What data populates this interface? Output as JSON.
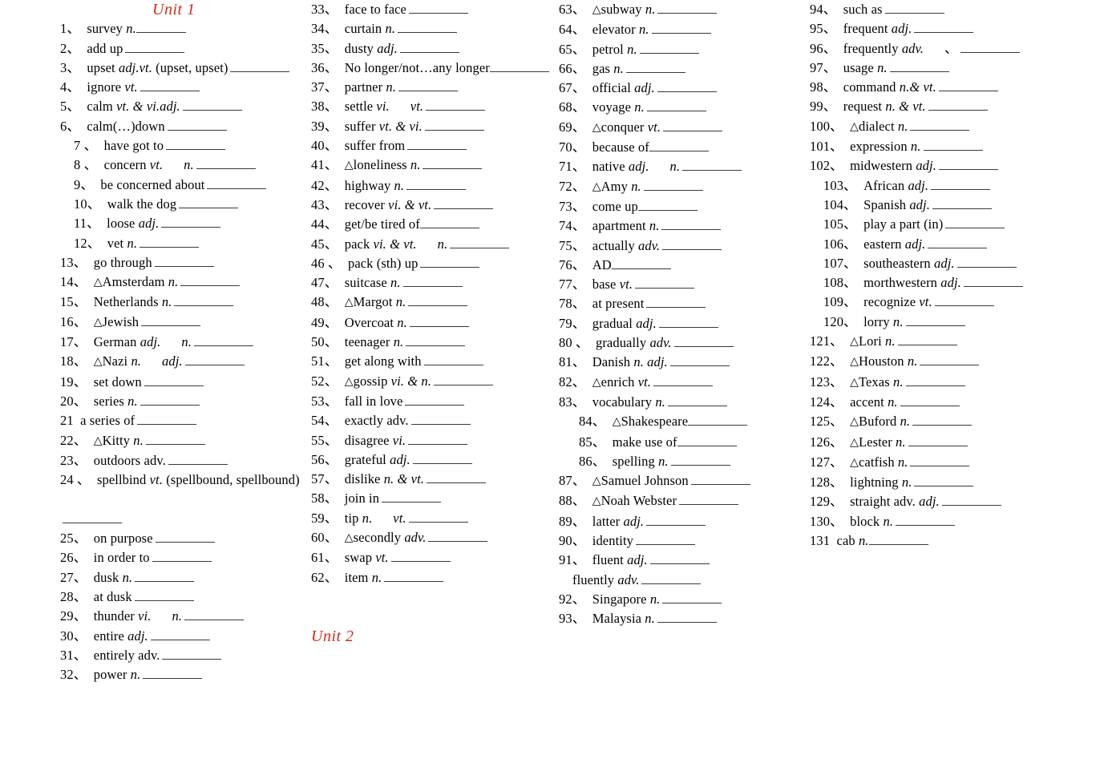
{
  "document": {
    "title": "Unit 1 & Unit 2 Vocabulary Worksheet",
    "accent_color": "#d42b1e",
    "text_color": "#000000",
    "background_color": "#ffffff",
    "rule_color": "#3a3a3a"
  },
  "headings": {
    "unit_1": "Unit 1",
    "unit_2": "Unit 2"
  },
  "columns": [
    {
      "id": "col-1",
      "heading": "Unit 1",
      "entries": [
        {
          "num": "1、",
          "word": "survey",
          "pos": "n.",
          "blank": "sm",
          "indent": 0,
          "space_before_blank": false
        },
        {
          "num": "2、",
          "word": "add up",
          "pos": "",
          "blank": "md",
          "indent": 0
        },
        {
          "num": "3、",
          "word": "upset",
          "pos": "adj.vt.",
          "tail": "(upset, upset)",
          "blank": "md",
          "indent": 0
        },
        {
          "num": "4、",
          "word": "ignore",
          "pos": "vt.",
          "blank": "md",
          "indent": 0
        },
        {
          "num": "5、",
          "word": "calm",
          "pos": "vt. & vi.adj.",
          "blank": "md",
          "indent": 0
        },
        {
          "num": "6、",
          "word": "calm(…)down",
          "pos": "",
          "blank": "md",
          "indent": 0
        },
        {
          "num": "7 、",
          "word": "have got to",
          "pos": "",
          "blank": "md",
          "indent": 1
        },
        {
          "num": "8 、",
          "word": "concern",
          "pos": "vt.",
          "pos2": "n.",
          "blank": "md",
          "indent": 1
        },
        {
          "num": "9、",
          "word": "be concerned about",
          "pos": "",
          "blank": "md",
          "indent": 1
        },
        {
          "num": "10、",
          "word": "walk the dog",
          "pos": "",
          "blank": "md",
          "indent": 1
        },
        {
          "num": "11、",
          "word": "loose",
          "pos": "adj.",
          "blank": "md",
          "indent": 1
        },
        {
          "num": "12、",
          "word": "vet",
          "pos": "n.",
          "blank": "md",
          "indent": 1
        },
        {
          "num": "13、",
          "word": "go through",
          "pos": "",
          "blank": "md",
          "indent": 0
        },
        {
          "num": "14、",
          "word": "Amsterdam",
          "pos": "n.",
          "triangle": true,
          "blank": "md",
          "indent": 0
        },
        {
          "num": "15、",
          "word": "Netherlands",
          "pos": "n.",
          "blank": "md",
          "indent": 0
        },
        {
          "num": "16、",
          "word": "Jewish",
          "pos": "",
          "triangle": true,
          "blank": "md",
          "indent": 0
        },
        {
          "num": "17、",
          "word": "German",
          "pos": "adj.",
          "pos2": "n.",
          "blank": "md",
          "indent": 0
        },
        {
          "num": "18、",
          "word": "Nazi",
          "pos": "n.",
          "pos2": "adj.",
          "triangle": true,
          "blank": "md",
          "indent": 0
        },
        {
          "num": "19、",
          "word": "set down",
          "pos": "",
          "blank": "md",
          "indent": 0
        },
        {
          "num": "20、",
          "word": "series",
          "pos": "n.",
          "blank": "md",
          "indent": 0
        },
        {
          "num": "21",
          "word": "a series of",
          "pos": "",
          "blank": "md",
          "indent": 0
        },
        {
          "num": "22、",
          "word": "Kitty",
          "pos": "n.",
          "triangle": true,
          "blank": "md",
          "indent": 0
        },
        {
          "num": "23、",
          "word": "outdoors adv.",
          "pos": "",
          "blank": "md",
          "indent": 0
        },
        {
          "num": "24 、",
          "word": "spellbind",
          "pos": "vt.",
          "tail": "(spellbound,  spellbound)",
          "blank": "md",
          "indent": 0,
          "wraps": true
        },
        {
          "num": "25、",
          "word": "on purpose",
          "pos": "",
          "blank": "md",
          "indent": 0
        },
        {
          "num": "26、",
          "word": "in order to",
          "pos": "",
          "blank": "md",
          "indent": 0
        },
        {
          "num": "27、",
          "word": "dusk",
          "pos": "n.",
          "blank": "md",
          "indent": 0
        },
        {
          "num": "28、",
          "word": "at dusk",
          "pos": "",
          "blank": "md",
          "indent": 0
        },
        {
          "num": "29、",
          "word": "thunder",
          "pos": "vi.",
          "pos2": "n.",
          "blank": "md",
          "indent": 0
        },
        {
          "num": "30、",
          "word": "entire",
          "pos": "adj.",
          "blank": "md",
          "indent": 0
        },
        {
          "num": "31、",
          "word": "entirely adv.",
          "pos": "",
          "blank": "md",
          "indent": 0
        },
        {
          "num": "32、",
          "word": "power",
          "pos": "n.",
          "blank": "md",
          "indent": 0
        }
      ]
    },
    {
      "id": "col-2",
      "heading": "Unit 2",
      "entries": [
        {
          "num": "33、",
          "word": "face to face",
          "pos": "",
          "blank": "md",
          "indent": 0
        },
        {
          "num": "34、",
          "word": "curtain",
          "pos": "n.",
          "blank": "md",
          "indent": 0
        },
        {
          "num": "35、",
          "word": "dusty",
          "pos": "adj.",
          "blank": "md",
          "indent": 0
        },
        {
          "num": "36、",
          "word": "No longer/not…any longer",
          "pos": "",
          "blank": "md",
          "indent": 0,
          "space_before_blank": false
        },
        {
          "num": "37、",
          "word": "partner",
          "pos": "n.",
          "blank": "md",
          "indent": 0
        },
        {
          "num": "38、",
          "word": "settle",
          "pos": "vi.",
          "pos2": "vt.",
          "blank": "md",
          "indent": 0
        },
        {
          "num": "39、",
          "word": "suffer",
          "pos": "vt. & vi.",
          "blank": "md",
          "indent": 0
        },
        {
          "num": "40、",
          "word": "suffer from",
          "pos": "",
          "blank": "md",
          "indent": 0
        },
        {
          "num": "41、",
          "word": "loneliness",
          "pos": "n.",
          "triangle": true,
          "blank": "md",
          "indent": 0
        },
        {
          "num": "42、",
          "word": "highway",
          "pos": "n.",
          "blank": "md",
          "indent": 0
        },
        {
          "num": "43、",
          "word": "recover",
          "pos": "vi. & vt.",
          "blank": "md",
          "indent": 0
        },
        {
          "num": "44、",
          "word": "get/be tired of",
          "pos": "",
          "blank": "md",
          "indent": 0,
          "space_before_blank": false
        },
        {
          "num": "45、",
          "word": "pack",
          "pos": "vi. & vt.",
          "pos2": "n.",
          "blank": "md",
          "indent": 0
        },
        {
          "num": "46 、",
          "word": "pack (sth) up",
          "pos": "",
          "blank": "md",
          "indent": 0
        },
        {
          "num": "47、",
          "word": "suitcase",
          "pos": "n.",
          "blank": "md",
          "indent": 0
        },
        {
          "num": "48、",
          "word": "Margot",
          "pos": "n.",
          "triangle": true,
          "blank": "md",
          "indent": 0
        },
        {
          "num": "49、",
          "word": "Overcoat",
          "pos": "n.",
          "blank": "md",
          "indent": 0
        },
        {
          "num": "50、",
          "word": "teenager",
          "pos": "n.",
          "blank": "md",
          "indent": 0
        },
        {
          "num": "51、",
          "word": "get along with",
          "pos": "",
          "blank": "md",
          "indent": 0
        },
        {
          "num": "52、",
          "word": "gossip",
          "pos": "vi. & n.",
          "triangle": true,
          "blank": "md",
          "indent": 0
        },
        {
          "num": "53、",
          "word": "fall in love",
          "pos": "",
          "blank": "md",
          "indent": 0
        },
        {
          "num": "54、",
          "word": "exactly adv.",
          "pos": "",
          "blank": "md",
          "indent": 0
        },
        {
          "num": "55、",
          "word": "disagree",
          "pos": "vi.",
          "blank": "md",
          "indent": 0
        },
        {
          "num": "56、",
          "word": "grateful",
          "pos": "adj.",
          "blank": "md",
          "indent": 0
        },
        {
          "num": "57、",
          "word": "dislike",
          "pos": "n. & vt.",
          "blank": "md",
          "indent": 0
        },
        {
          "num": "58、",
          "word": "join in",
          "pos": "",
          "blank": "md",
          "indent": 0
        },
        {
          "num": "59、",
          "word": "tip",
          "pos": "n.",
          "pos2": "vt.",
          "blank": "md",
          "indent": 0
        },
        {
          "num": "60、",
          "word": "secondly",
          "pos": "adv.",
          "triangle": true,
          "blank": "md",
          "indent": 0
        },
        {
          "num": "61、",
          "word": "swap",
          "pos": "vt.",
          "blank": "md",
          "indent": 0
        },
        {
          "num": "62、",
          "word": "item",
          "pos": "n.",
          "blank": "md",
          "indent": 0
        }
      ]
    },
    {
      "id": "col-3",
      "heading": "",
      "entries": [
        {
          "num": "63、",
          "word": "subway",
          "pos": "n.",
          "triangle": true,
          "blank": "md",
          "indent": 0
        },
        {
          "num": "64、",
          "word": "elevator",
          "pos": "n.",
          "blank": "md",
          "indent": 0
        },
        {
          "num": "65、",
          "word": "petrol",
          "pos": "n.",
          "blank": "md",
          "indent": 0
        },
        {
          "num": "66、",
          "word": "gas",
          "pos": "n.",
          "blank": "md",
          "indent": 0
        },
        {
          "num": "67、",
          "word": "official",
          "pos": "adj.",
          "blank": "md",
          "indent": 0
        },
        {
          "num": "68、",
          "word": "voyage",
          "pos": "n.",
          "blank": "md",
          "indent": 0
        },
        {
          "num": "69、",
          "word": "conquer",
          "pos": "vt.",
          "triangle": true,
          "blank": "md",
          "indent": 0
        },
        {
          "num": "70、",
          "word": "because of",
          "pos": "",
          "blank": "md",
          "indent": 0,
          "space_before_blank": false
        },
        {
          "num": "71、",
          "word": "native",
          "pos": "adj.",
          "pos2": "n.",
          "blank": "md",
          "indent": 0
        },
        {
          "num": "72、",
          "word": "Amy",
          "pos": "n.",
          "triangle": true,
          "blank": "md",
          "indent": 0
        },
        {
          "num": "73、",
          "word": "come up",
          "pos": "",
          "blank": "md",
          "indent": 0,
          "space_before_blank": false
        },
        {
          "num": "74、",
          "word": "apartment",
          "pos": "n.",
          "blank": "md",
          "indent": 0
        },
        {
          "num": "75、",
          "word": "actually",
          "pos": "adv.",
          "blank": "md",
          "indent": 0
        },
        {
          "num": "76、",
          "word": "AD",
          "pos": "",
          "blank": "md",
          "indent": 0,
          "space_before_blank": false
        },
        {
          "num": "77、",
          "word": "base",
          "pos": "vt.",
          "blank": "md",
          "indent": 0
        },
        {
          "num": "78、",
          "word": "at present",
          "pos": "",
          "blank": "md",
          "indent": 0
        },
        {
          "num": "79、",
          "word": "gradual",
          "pos": "adj.",
          "blank": "md",
          "indent": 0
        },
        {
          "num": "80 、",
          "word": "gradually",
          "pos": "adv.",
          "blank": "md",
          "indent": 0
        },
        {
          "num": "81、",
          "word": "Danish",
          "pos": "n. adj.",
          "blank": "md",
          "indent": 0
        },
        {
          "num": "82、",
          "word": "enrich",
          "pos": "vt.",
          "triangle": true,
          "blank": "md",
          "indent": 0
        },
        {
          "num": "83、",
          "word": "vocabulary",
          "pos": "n.",
          "blank": "md",
          "indent": 0
        },
        {
          "num": "84、",
          "word": "Shakespeare",
          "pos": "",
          "triangle": true,
          "blank": "md",
          "indent": 2,
          "space_before_blank": false
        },
        {
          "num": "85、",
          "word": "make use of",
          "pos": "",
          "blank": "md",
          "indent": 2,
          "space_before_blank": false
        },
        {
          "num": "86、",
          "word": "spelling",
          "pos": "n.",
          "blank": "md",
          "indent": 2
        },
        {
          "num": "87、",
          "word": "Samuel Johnson",
          "pos": "",
          "triangle": true,
          "blank": "md",
          "indent": 0
        },
        {
          "num": "88、",
          "word": "Noah Webster",
          "pos": "",
          "triangle": true,
          "blank": "md",
          "indent": 0
        },
        {
          "num": "89、",
          "word": "latter",
          "pos": "adj.",
          "blank": "md",
          "indent": 0
        },
        {
          "num": "90、",
          "word": "identity",
          "pos": "",
          "blank": "md",
          "indent": 0
        },
        {
          "num": "91、",
          "word": "fluent",
          "pos": "adj.",
          "blank": "md",
          "indent": 0
        },
        {
          "num": "",
          "word": "fluently",
          "pos": "adv.",
          "blank": "md",
          "indent": 1
        },
        {
          "num": "92、",
          "word": "Singapore",
          "pos": "n.",
          "blank": "md",
          "indent": 0
        },
        {
          "num": "93、",
          "word": "Malaysia",
          "pos": "n.",
          "blank": "md",
          "indent": 0
        }
      ]
    },
    {
      "id": "col-4",
      "heading": "",
      "entries": [
        {
          "num": "94、",
          "word": "such as",
          "pos": "",
          "blank": "md",
          "indent": 0
        },
        {
          "num": "95、",
          "word": "frequent",
          "pos": "adj.",
          "blank": "md",
          "indent": 0
        },
        {
          "num": "96、",
          "word": "frequently",
          "pos": "adv.",
          "pos2": "、",
          "blank": "md",
          "indent": 0
        },
        {
          "num": "97、",
          "word": "usage",
          "pos": "n.",
          "blank": "md",
          "indent": 0
        },
        {
          "num": "98、",
          "word": "command",
          "pos": "n.& vt.",
          "blank": "md",
          "indent": 0
        },
        {
          "num": "99、",
          "word": "request",
          "pos": "n. & vt.",
          "blank": "md",
          "indent": 0
        },
        {
          "num": "100、",
          "word": "dialect",
          "pos": "n.",
          "triangle": true,
          "blank": "md",
          "indent": 0
        },
        {
          "num": "101、",
          "word": "expression",
          "pos": "n.",
          "blank": "md",
          "indent": 0
        },
        {
          "num": "102、",
          "word": "midwestern",
          "pos": "adj.",
          "blank": "md",
          "indent": 0
        },
        {
          "num": "103、",
          "word": "African",
          "pos": "adj.",
          "blank": "md",
          "indent": 1
        },
        {
          "num": "104、",
          "word": "Spanish",
          "pos": "adj.",
          "blank": "md",
          "indent": 1
        },
        {
          "num": "105、",
          "word": "play a part (in)",
          "pos": "",
          "blank": "md",
          "indent": 1
        },
        {
          "num": "106、",
          "word": "eastern",
          "pos": "adj.",
          "blank": "md",
          "indent": 1
        },
        {
          "num": "107、",
          "word": "southeastern",
          "pos": "adj.",
          "blank": "md",
          "indent": 1
        },
        {
          "num": "108、",
          "word": "morthwestern",
          "pos": "adj.",
          "blank": "md",
          "indent": 1
        },
        {
          "num": "109、",
          "word": "recognize",
          "pos": "vt.",
          "blank": "md",
          "indent": 1
        },
        {
          "num": "120、",
          "word": "lorry",
          "pos": "n.",
          "blank": "md",
          "indent": 1
        },
        {
          "num": "121、",
          "word": "Lori",
          "pos": "n.",
          "triangle": true,
          "blank": "md",
          "indent": 0
        },
        {
          "num": "122、",
          "word": "Houston",
          "pos": "n.",
          "triangle": true,
          "blank": "md",
          "indent": 0
        },
        {
          "num": "123、",
          "word": "Texas",
          "pos": "n.",
          "triangle": true,
          "blank": "md",
          "indent": 0
        },
        {
          "num": "124、",
          "word": "accent",
          "pos": "n.",
          "blank": "md",
          "indent": 0
        },
        {
          "num": "125、",
          "word": "Buford",
          "pos": "n.",
          "triangle": true,
          "blank": "md",
          "indent": 0
        },
        {
          "num": "126、",
          "word": "Lester",
          "pos": "n.",
          "triangle": true,
          "blank": "md",
          "indent": 0
        },
        {
          "num": "127、",
          "word": "catfish",
          "pos": "n.",
          "triangle": true,
          "blank": "md",
          "indent": 0
        },
        {
          "num": "128、",
          "word": "lightning",
          "pos": "n.",
          "blank": "md",
          "indent": 0
        },
        {
          "num": "129、",
          "word": "straight adv.",
          "pos": "adj.",
          "blank": "md",
          "indent": 0
        },
        {
          "num": "130、",
          "word": "block",
          "pos": "n.",
          "blank": "md",
          "indent": 0
        },
        {
          "num": "131",
          "word": "cab",
          "pos": "n.",
          "blank": "md",
          "indent": 0,
          "space_before_blank": false
        }
      ]
    }
  ]
}
